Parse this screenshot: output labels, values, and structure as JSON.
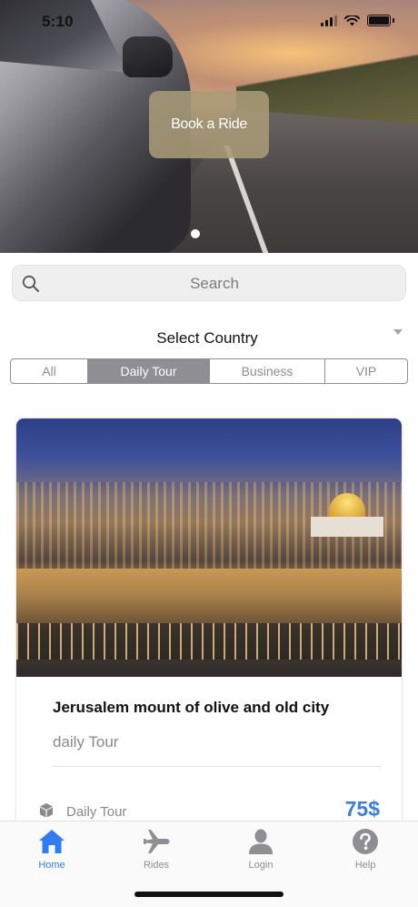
{
  "status_bar": {
    "time": "5:10"
  },
  "hero": {
    "book_ride_label": "Book a Ride"
  },
  "search": {
    "placeholder": "Search"
  },
  "country_select": {
    "label": "Select Country"
  },
  "segments": [
    {
      "label": "All",
      "active": false
    },
    {
      "label": "Daily Tour",
      "active": true
    },
    {
      "label": "Business",
      "active": false
    },
    {
      "label": "VIP",
      "active": false
    }
  ],
  "tour_card": {
    "title": "Jerusalem mount of olive and old city",
    "subtitle": "daily Tour",
    "type_label": "Daily Tour",
    "price": "75$",
    "type_icon": "box-icon"
  },
  "tab_bar": {
    "items": [
      {
        "label": "Home",
        "icon": "home-icon",
        "active": true
      },
      {
        "label": "Rides",
        "icon": "airplane-icon",
        "active": false
      },
      {
        "label": "Login",
        "icon": "person-icon",
        "active": false
      },
      {
        "label": "Help",
        "icon": "help-icon",
        "active": false
      }
    ]
  },
  "colors": {
    "accent": "#2f7cf6",
    "price": "#3a7ee0",
    "segment_active": "#8e8e93",
    "book_button": "#a89b78"
  }
}
